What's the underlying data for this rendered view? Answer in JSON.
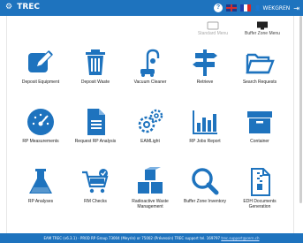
{
  "header": {
    "brand": "TREC",
    "help_label": "?",
    "user_name": "WEKGREN",
    "colors": {
      "primary": "#1e73be",
      "icon": "#1e73be"
    },
    "icons": [
      "gear-icon",
      "help-icon",
      "flag-uk-icon",
      "flag-fr-icon",
      "user-icon",
      "logout-icon"
    ]
  },
  "top_menus": [
    {
      "label": "Standard Menu",
      "enabled": false
    },
    {
      "label": "Buffer Zone Menu",
      "enabled": true
    }
  ],
  "tiles": [
    {
      "label": "Deposit Equipment",
      "icon": "edit-icon"
    },
    {
      "label": "Deposit Waste",
      "icon": "trash-icon"
    },
    {
      "label": "Vacuum Cleaner",
      "icon": "vacuum-icon"
    },
    {
      "label": "Retrieve",
      "icon": "signpost-icon"
    },
    {
      "label": "Search Requests",
      "icon": "folder-open-icon"
    },
    {
      "label": "RP Measurements",
      "icon": "gauge-icon"
    },
    {
      "label": "Request RP Analysis",
      "icon": "document-icon"
    },
    {
      "label": "EAMLight",
      "icon": "gears-icon"
    },
    {
      "label": "RP Jobs Report",
      "icon": "barchart-icon"
    },
    {
      "label": "Container",
      "icon": "archive-box-icon"
    },
    {
      "label": "RP Analyses",
      "icon": "flask-icon"
    },
    {
      "label": "RM Checks",
      "icon": "cart-check-icon"
    },
    {
      "label": "Radioactive Waste Management",
      "icon": "cubes-icon"
    },
    {
      "label": "Buffer Zone Inventory",
      "icon": "magnifier-icon"
    },
    {
      "label": "EDH Documents Generation",
      "icon": "zip-file-icon"
    }
  ],
  "footer": {
    "text": "EAM TREC (v6.3.1) - PR0D  RP Group 73004 (Meyrin) or 75002 (Prévessin)  TREC support tel. 169797",
    "link": "trec.support@cern.ch"
  }
}
